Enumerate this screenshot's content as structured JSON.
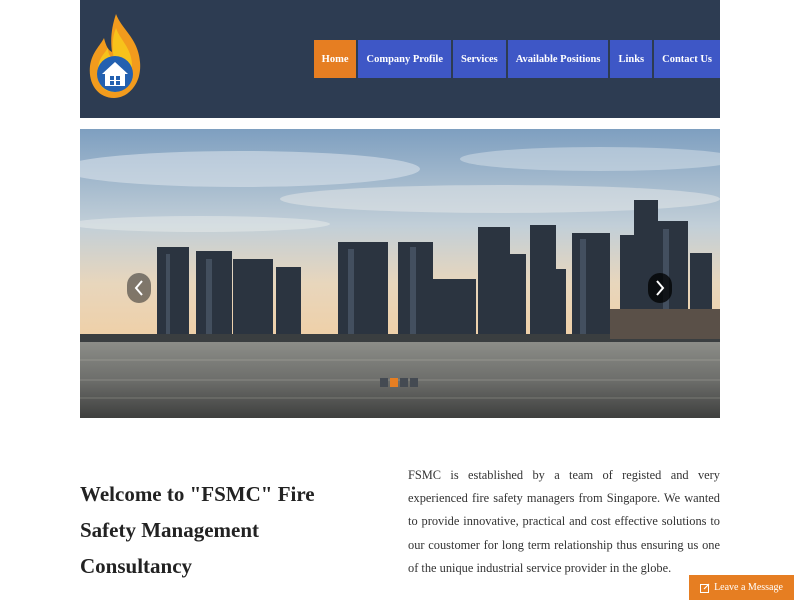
{
  "nav": {
    "items": [
      {
        "label": "Home",
        "active": true
      },
      {
        "label": "Company Profile",
        "active": false
      },
      {
        "label": "Services",
        "active": false
      },
      {
        "label": "Available Positions",
        "active": false
      },
      {
        "label": "Links",
        "active": false
      },
      {
        "label": "Contact Us",
        "active": false
      }
    ]
  },
  "hero": {
    "slide_count": 4,
    "active_slide": 2
  },
  "welcome": {
    "prefix": "Welcome to ",
    "brand": "\"FSMC\"",
    "suffix": " Fire Safety Management Consultancy"
  },
  "about": {
    "text": "FSMC is established by a team of registed and very experienced fire safety managers from Singapore. We wanted to provide innovative, practical and cost effective solutions to our coustomer for long term relationship thus ensuring us one of the unique industrial service provider in the globe."
  },
  "leave_message": {
    "label": "Leave a Message"
  },
  "colors": {
    "header_bg": "#2d3c52",
    "nav_bg": "#3e57c6",
    "accent": "#e67e22"
  }
}
